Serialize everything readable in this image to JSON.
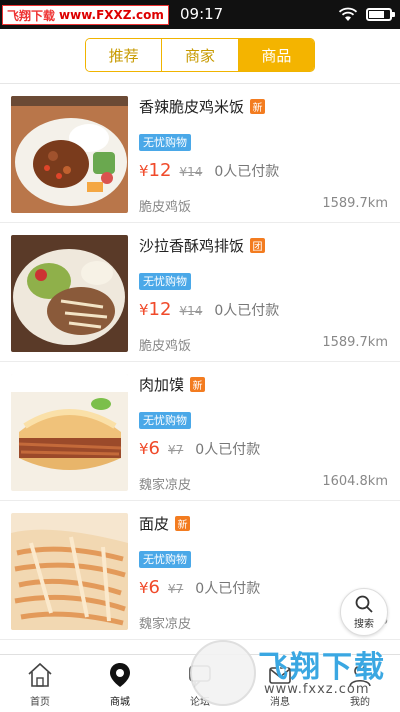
{
  "status_bar": {
    "watermark_left": "飞翔下载",
    "watermark_url": "www.FXXZ.com",
    "time": "09:17"
  },
  "tabs": [
    {
      "label": "推荐",
      "active": false
    },
    {
      "label": "商家",
      "active": false
    },
    {
      "label": "商品",
      "active": true
    }
  ],
  "items": [
    {
      "title": "香辣脆皮鸡米饭",
      "badge": "新",
      "tag": "无忧购物",
      "price": "12",
      "currency": "¥",
      "original_price": "¥14",
      "paid": "0人已付款",
      "merchant": "脆皮鸡饭",
      "distance": "1589.7km"
    },
    {
      "title": "沙拉香酥鸡排饭",
      "badge": "团",
      "tag": "无忧购物",
      "price": "12",
      "currency": "¥",
      "original_price": "¥14",
      "paid": "0人已付款",
      "merchant": "脆皮鸡饭",
      "distance": "1589.7km"
    },
    {
      "title": "肉加馍",
      "badge": "新",
      "tag": "无忧购物",
      "price": "6",
      "currency": "¥",
      "original_price": "¥7",
      "paid": "0人已付款",
      "merchant": "魏家凉皮",
      "distance": "1604.8km"
    },
    {
      "title": "面皮",
      "badge": "新",
      "tag": "无忧购物",
      "price": "6",
      "currency": "¥",
      "original_price": "¥7",
      "paid": "0人已付款",
      "merchant": "魏家凉皮",
      "distance": "16"
    }
  ],
  "search_fab": {
    "label": "搜索",
    "icon": "search-icon"
  },
  "bottom_nav": [
    {
      "label": "首页",
      "icon": "home-icon",
      "active": false
    },
    {
      "label": "商城",
      "icon": "location-pin-icon",
      "active": true
    },
    {
      "label": "论坛",
      "icon": "forum-icon",
      "active": false
    },
    {
      "label": "消息",
      "icon": "message-icon",
      "active": false
    },
    {
      "label": "我的",
      "icon": "user-icon",
      "active": false
    }
  ],
  "watermark_bottom": {
    "big": "飞翔下载",
    "small": "www.fxxz.com"
  },
  "colors": {
    "accent": "#f4b400",
    "price": "#f04a2a",
    "tag": "#4aa8e8",
    "badge": "#f37c20"
  }
}
